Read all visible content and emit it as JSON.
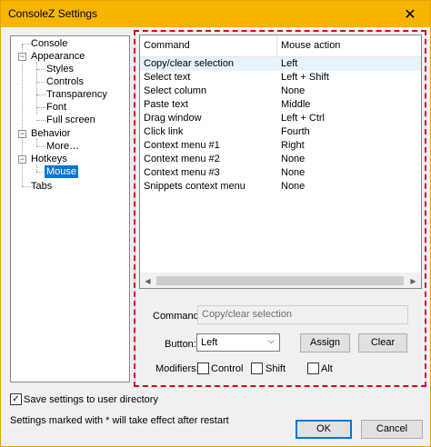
{
  "window": {
    "title": "ConsoleZ Settings",
    "close_glyph": "✕"
  },
  "tree": {
    "items": [
      {
        "label": "Console"
      },
      {
        "label": "Appearance",
        "expander": "−"
      },
      {
        "label": "Styles"
      },
      {
        "label": "Controls"
      },
      {
        "label": "Transparency"
      },
      {
        "label": "Font"
      },
      {
        "label": "Full screen"
      },
      {
        "label": "Behavior",
        "expander": "−"
      },
      {
        "label": "More…"
      },
      {
        "label": "Hotkeys",
        "expander": "−"
      },
      {
        "label": "Mouse",
        "selected": true
      },
      {
        "label": "Tabs"
      }
    ]
  },
  "list": {
    "headers": [
      "Command",
      "Mouse action"
    ],
    "rows": [
      [
        "Copy/clear selection",
        "Left"
      ],
      [
        "Select text",
        "Left + Shift"
      ],
      [
        "Select column",
        "None"
      ],
      [
        "Paste text",
        "Middle"
      ],
      [
        "Drag window",
        "Left + Ctrl"
      ],
      [
        "Click link",
        "Fourth"
      ],
      [
        "Context menu #1",
        "Right"
      ],
      [
        "Context menu #2",
        "None"
      ],
      [
        "Context menu #3",
        "None"
      ],
      [
        "Snippets context menu",
        "None"
      ]
    ],
    "selected_row": 0
  },
  "editor": {
    "command_label": "Command:",
    "command_value": "Copy/clear selection",
    "button_label": "Button:",
    "button_value": "Left",
    "assign_label": "Assign",
    "clear_label": "Clear",
    "modifiers_label": "Modifiers:",
    "control_label": "Control",
    "shift_label": "Shift",
    "alt_label": "Alt"
  },
  "footer": {
    "save_label": "Save settings to user directory",
    "save_checked": true,
    "restart_note": "Settings marked with * will take effect after restart",
    "ok_label": "OK",
    "cancel_label": "Cancel"
  },
  "colors": {
    "titlebar": "#f7b500",
    "selection": "#0078d7",
    "highlight_frame": "#e0001a"
  }
}
